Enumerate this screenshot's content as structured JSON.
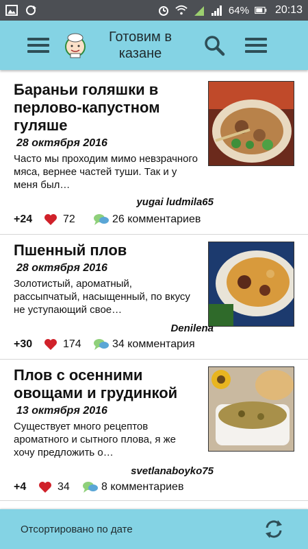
{
  "status_bar": {
    "battery": "64%",
    "time": "20:13",
    "icons": [
      "gallery-icon",
      "sync-icon",
      "alarm-icon",
      "wifi-icon",
      "sim1-signal-icon",
      "signal-icon",
      "battery-icon"
    ]
  },
  "app_bar": {
    "title": "Готовим в казане",
    "icons": [
      "hamburger-icon",
      "chef-logo",
      "search-icon",
      "menu-icon"
    ]
  },
  "recipes": [
    {
      "title": "Бараньи голяшки в перлово-капустном гуляше",
      "date": "28 октября 2016",
      "excerpt": "Часто мы проходим мимо невзрачного мяса, вернее частей туши. Так и у меня был…",
      "author": "yugai ludmila65",
      "votes": "+24",
      "likes": "72",
      "comments": "26 комментариев"
    },
    {
      "title": "Пшенный плов",
      "date": "28 октября 2016",
      "excerpt": "Золотистый, ароматный, рассыпчатый, насыщенный, по вкусу не уступающий свое…",
      "author": "Denilena",
      "votes": "+30",
      "likes": "174",
      "comments": "34 комментария"
    },
    {
      "title": "Плов с осенними овощами и грудинкой",
      "date": "13 октября 2016",
      "excerpt": "Существует много рецептов ароматного и сытного плова, я же хочу предложить о…",
      "author": "svetlanaboyko75",
      "votes": "+4",
      "likes": "34",
      "comments": "8 комментариев"
    }
  ],
  "footer": {
    "sort_label": "Отсортировано по дате"
  },
  "colors": {
    "app_bar": "#84d3e4",
    "status_bar": "#4c4f54",
    "heart": "#d0212a",
    "bubble": "#7cc16a"
  }
}
